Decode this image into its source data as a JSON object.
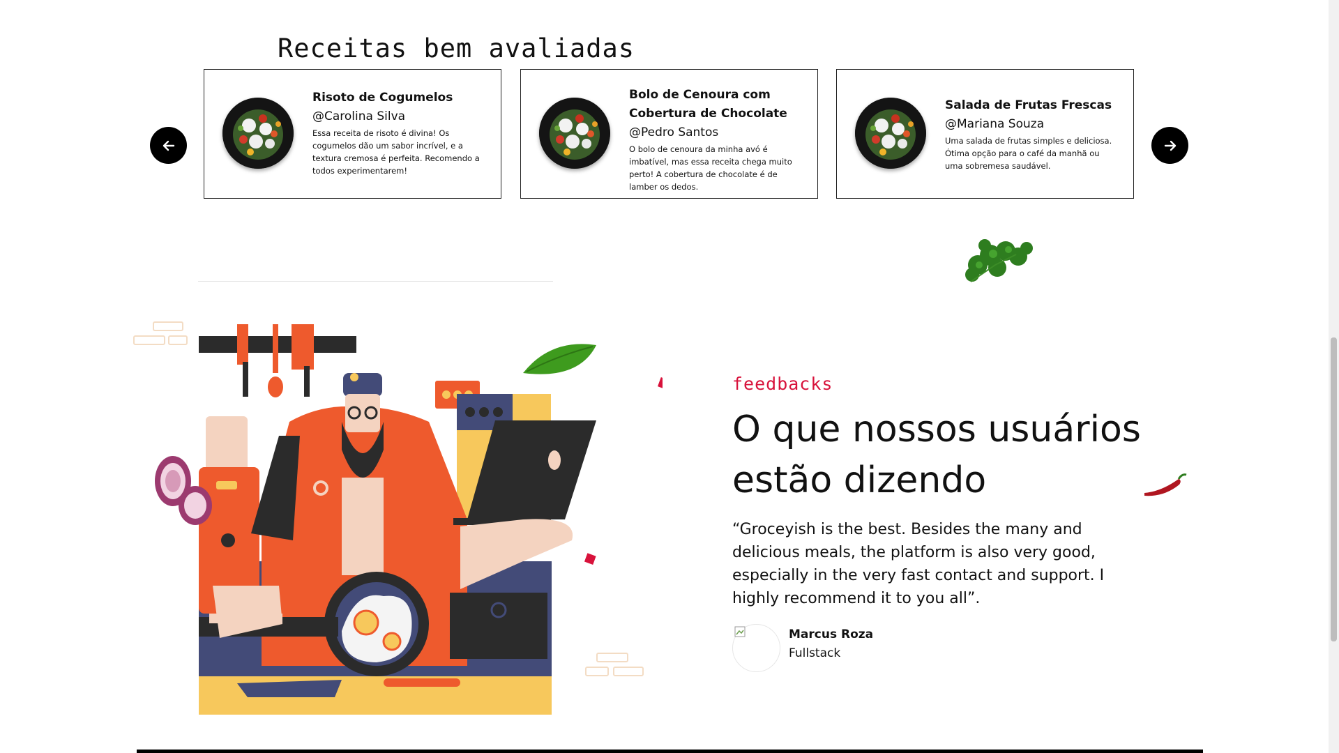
{
  "recipes_section": {
    "title": "Receitas bem avaliadas",
    "cards": [
      {
        "title": "Risoto de Cogumelos",
        "author": "@Carolina Silva",
        "description": "Essa receita de risoto é divina! Os cogumelos dão um sabor incrível, e a textura cremosa é perfeita. Recomendo a todos experimentarem!"
      },
      {
        "title": "Bolo de Cenoura com Cobertura de Chocolate",
        "author": "@Pedro Santos",
        "description": "O bolo de cenoura da minha avó é imbatível, mas essa receita chega muito perto! A cobertura de chocolate é de lamber os dedos."
      },
      {
        "title": "Salada de Frutas Frescas",
        "author": "@Mariana Souza",
        "description": "Uma salada de frutas simples e deliciosa. Ótima opção para o café da manhã ou uma sobremesa saudável."
      }
    ]
  },
  "feedback_section": {
    "label": "feedbacks",
    "heading": "O que nossos usuários estão dizendo",
    "quote": "“Groceyish is the best. Besides the many and delicious meals, the platform is also very good, especially in the very fast contact and support. I highly recommend it to you all”.",
    "reviewer": {
      "name": "Marcus Roza",
      "role": "Fullstack"
    }
  },
  "icons": {
    "prev": "arrow-left-icon",
    "next": "arrow-right-icon"
  },
  "colors": {
    "accent": "#d8123b",
    "illustration_orange": "#ee5a2d",
    "illustration_navy": "#434b78",
    "illustration_yellow": "#f7c85c"
  }
}
